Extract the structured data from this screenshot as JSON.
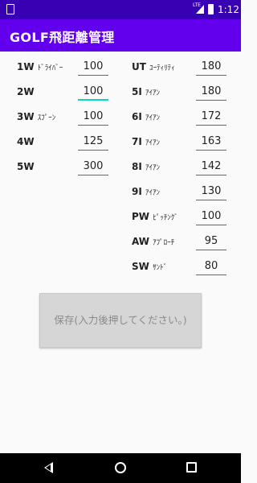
{
  "status_bar": {
    "time": "1:12",
    "network": "LTE"
  },
  "app_bar": {
    "title": "GOLF飛距離管理"
  },
  "left_column": [
    {
      "club": "1W",
      "kana": "ﾄﾞﾗｲﾊﾞｰ",
      "distance": "100"
    },
    {
      "club": "2W",
      "kana": "",
      "distance": "100"
    },
    {
      "club": "3W",
      "kana": "ｽﾌﾟｰﾝ",
      "distance": "100"
    },
    {
      "club": "4W",
      "kana": "",
      "distance": "125"
    },
    {
      "club": "5W",
      "kana": "",
      "distance": "300"
    }
  ],
  "right_column": [
    {
      "club": "UT",
      "kana": "ﾕｰﾃｨﾘﾃｨ",
      "distance": "180"
    },
    {
      "club": "5I",
      "kana": "ｱｲｱﾝ",
      "distance": "180"
    },
    {
      "club": "6I",
      "kana": "ｱｲｱﾝ",
      "distance": "172"
    },
    {
      "club": "7I",
      "kana": "ｱｲｱﾝ",
      "distance": "163"
    },
    {
      "club": "8I",
      "kana": "ｱｲｱﾝ",
      "distance": "142"
    },
    {
      "club": "9I",
      "kana": "ｱｲｱﾝ",
      "distance": "130"
    },
    {
      "club": "PW",
      "kana": "ﾋﾟｯﾁﾝｸﾞ",
      "distance": "100"
    },
    {
      "club": "AW",
      "kana": "ｱﾌﾟﾛｰﾁ",
      "distance": "95"
    },
    {
      "club": "SW",
      "kana": "ｻﾝﾄﾞ",
      "distance": "80"
    }
  ],
  "save_button": {
    "label": "保存(入力後押してください。)"
  },
  "colors": {
    "status_bar": "#3700b3",
    "app_bar": "#6200ee",
    "focus_underline": "#03dac5",
    "button_bg": "#d6d6d6"
  }
}
